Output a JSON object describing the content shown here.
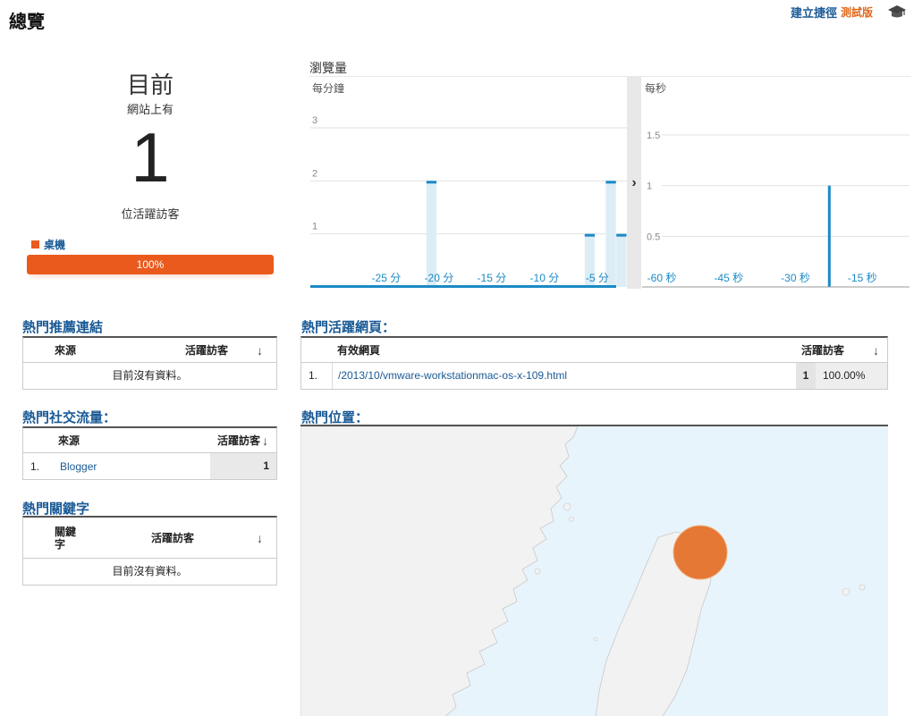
{
  "header": {
    "title": "總覽",
    "create_shortcut": "建立捷徑",
    "beta": "測試版"
  },
  "summary": {
    "now_label": "目前",
    "site_has": "網站上有",
    "active_count": "1",
    "active_visitors_label": "位活躍訪客",
    "device_label": "桌機",
    "device_percent": "100%",
    "device_fraction": 1.0,
    "device_color": "#ea5a1c"
  },
  "pageviews": {
    "title": "瀏覽量",
    "per_minute_label": "每分鐘",
    "per_second_label": "每秒",
    "expand_arrow": "›"
  },
  "chart_data": [
    {
      "type": "bar",
      "title": "每分鐘",
      "x_ticks": [
        "-25 分",
        "-20 分",
        "-15 分",
        "-10 分",
        "-5 分"
      ],
      "x": [
        -30,
        -29,
        -28,
        -27,
        -26,
        -25,
        -24,
        -23,
        -22,
        -21,
        -20,
        -19,
        -18,
        -17,
        -16,
        -15,
        -14,
        -13,
        -12,
        -11,
        -10,
        -9,
        -8,
        -7,
        -6,
        -5,
        -4,
        -3,
        -2,
        -1
      ],
      "values": [
        0,
        0,
        0,
        0,
        0,
        0,
        0,
        0,
        0,
        0,
        0,
        2,
        0,
        0,
        0,
        0,
        0,
        0,
        0,
        0,
        0,
        0,
        0,
        0,
        0,
        0,
        1,
        0,
        2,
        1
      ],
      "ylim": [
        0,
        3
      ],
      "y_ticks": [
        "1",
        "2",
        "3"
      ],
      "grid": true,
      "color": "#1b8ac6"
    },
    {
      "type": "bar",
      "title": "每秒",
      "x_ticks": [
        "-60 秒",
        "-45 秒",
        "-30 秒",
        "-15 秒"
      ],
      "x_range": [
        -60,
        0
      ],
      "points": [
        {
          "x": -18,
          "y": 1
        }
      ],
      "ylim": [
        0,
        1.5
      ],
      "y_ticks": [
        "0.5",
        "1",
        "1.5"
      ],
      "grid": true,
      "color": "#1b8ac6"
    }
  ],
  "referrals": {
    "title": "熱門推薦連結",
    "col_source": "來源",
    "col_active": "活躍訪客",
    "empty": "目前沒有資料。"
  },
  "social": {
    "title": "熱門社交流量：",
    "col_source": "來源",
    "col_active": "活躍訪客",
    "rows": [
      {
        "index": "1.",
        "name": "Blogger",
        "count": "1"
      }
    ]
  },
  "keywords": {
    "title": "熱門關鍵字",
    "col_keyword": "關鍵字",
    "col_active": "活躍訪客",
    "empty": "目前沒有資料。"
  },
  "active_pages": {
    "title": "熱門活躍網頁：",
    "col_page": "有效網頁",
    "col_active": "活躍訪客",
    "rows": [
      {
        "index": "1.",
        "path": "/2013/10/vmware-workstationmac-os-x-109.html",
        "count": "1",
        "percent": "100.00%"
      }
    ]
  },
  "locations": {
    "title": "熱門位置："
  }
}
